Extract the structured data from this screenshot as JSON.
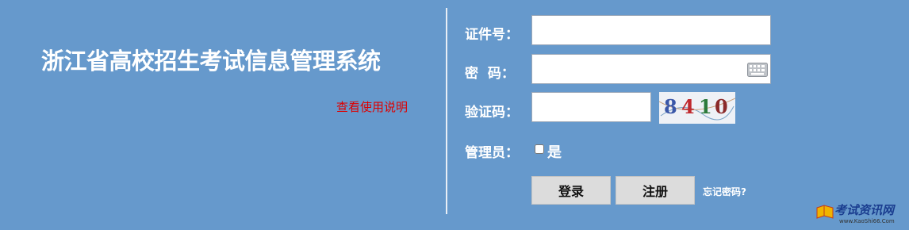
{
  "header": {
    "title": "浙江省高校招生考试信息管理系统",
    "help_link": "查看使用说明"
  },
  "form": {
    "id_label": "证件号：",
    "password_label": "密  码：",
    "captcha_label": "验证码：",
    "admin_label": "管理员：",
    "admin_checkbox_text": "是",
    "captcha_image_text": "8410",
    "id_value": "",
    "password_value": "",
    "captcha_value": ""
  },
  "buttons": {
    "login": "登录",
    "register": "注册",
    "forgot_password": "忘记密码?"
  },
  "watermark": {
    "text": "考试资讯网",
    "sub": "www.KaoShi66.Com"
  },
  "colors": {
    "background": "#6699cc",
    "help_link": "#dd0000",
    "button": "#dcdcdc"
  }
}
